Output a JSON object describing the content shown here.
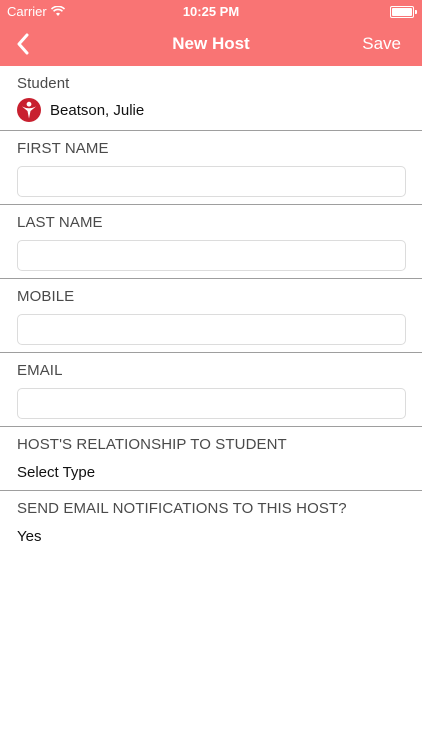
{
  "status_bar": {
    "carrier": "Carrier",
    "time": "10:25 PM"
  },
  "nav": {
    "back_icon": "chevron-left-icon",
    "title": "New Host",
    "save_label": "Save"
  },
  "student": {
    "label": "Student",
    "name": "Beatson, Julie"
  },
  "fields": {
    "first_name": {
      "label": "FIRST NAME",
      "value": ""
    },
    "last_name": {
      "label": "LAST NAME",
      "value": ""
    },
    "mobile": {
      "label": "MOBILE",
      "value": ""
    },
    "email": {
      "label": "EMAIL",
      "value": ""
    }
  },
  "relationship": {
    "label": "HOST'S RELATIONSHIP TO STUDENT",
    "value": "Select Type"
  },
  "notifications": {
    "label": "SEND EMAIL NOTIFICATIONS TO THIS HOST?",
    "value": "Yes"
  },
  "colors": {
    "header": "#f97474",
    "divider": "#9e9e9e",
    "input_border": "#dcdcdc",
    "logo": "#c8202f"
  }
}
